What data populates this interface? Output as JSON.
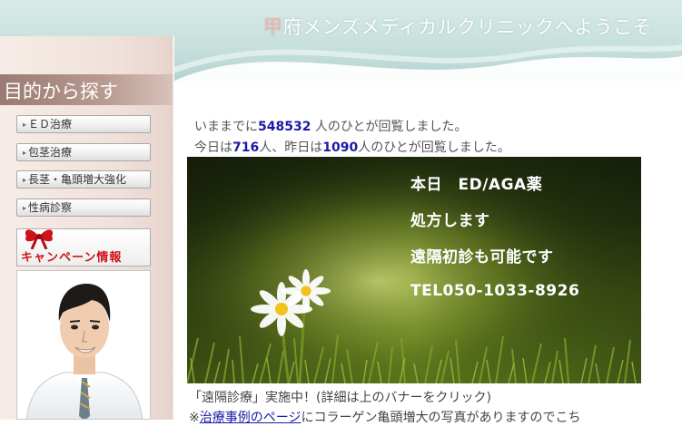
{
  "header": {
    "title_first_char": "甲",
    "title_rest": "府メンズメディカルクリニックへようこそ"
  },
  "sidebar": {
    "section_title": "目的から探す",
    "items": [
      {
        "label": "ＥＤ治療"
      },
      {
        "label": "包茎治療"
      },
      {
        "label": "長茎・亀頭増大強化"
      },
      {
        "label": "性病診察"
      }
    ],
    "campaign_label": "キャンペーン情報"
  },
  "main": {
    "visitors": {
      "prefix": "いままでに",
      "total": "548532",
      "suffix": "人のひとが回覧しました。",
      "today_prefix": "今日は",
      "today": "716",
      "mid": "人、昨日は",
      "yesterday": "1090",
      "today_suffix": "人のひとが回覧しました。"
    },
    "banner": {
      "line1": "本日　ED/AGA薬",
      "line2": "処方します",
      "line3": "遠隔初診も可能です",
      "line4": "TEL050-1033-8926"
    },
    "remote_note": "「遠隔診療」実施中！(詳細は上のバナーをクリック)",
    "cases_note": {
      "prefix": "※",
      "link": "治療事例のページ",
      "suffix": "にコラーゲン亀頭増大の写真がありますのでこち"
    }
  },
  "colors": {
    "header_bg": "#c6dfdc",
    "sidebar_bg": "#efe0da",
    "section_head": "#9b7b71",
    "link_blue": "#1a1aa6",
    "campaign_red": "#d0121b"
  }
}
